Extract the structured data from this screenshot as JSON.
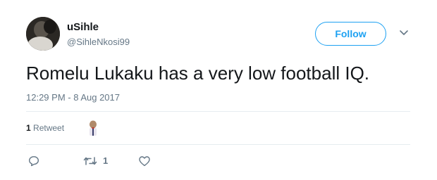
{
  "user": {
    "name": "uSihle",
    "handle": "@SihleNkosi99"
  },
  "follow_button": {
    "label": "Follow"
  },
  "tweet": {
    "text": "Romelu Lukaku has a very low football IQ.",
    "timestamp": "12:29 PM - 8 Aug 2017"
  },
  "stats": {
    "retweet_count": "1",
    "retweet_label": "Retweet"
  },
  "actions": {
    "retweet_count": "1"
  },
  "icons": {
    "menu": "chevron-down-icon",
    "reply": "reply-icon",
    "retweet": "retweet-icon",
    "like": "heart-icon"
  },
  "colors": {
    "accent": "#1da1f2",
    "secondary_text": "#657786",
    "primary_text": "#14171a",
    "divider": "#e6ecf0"
  }
}
